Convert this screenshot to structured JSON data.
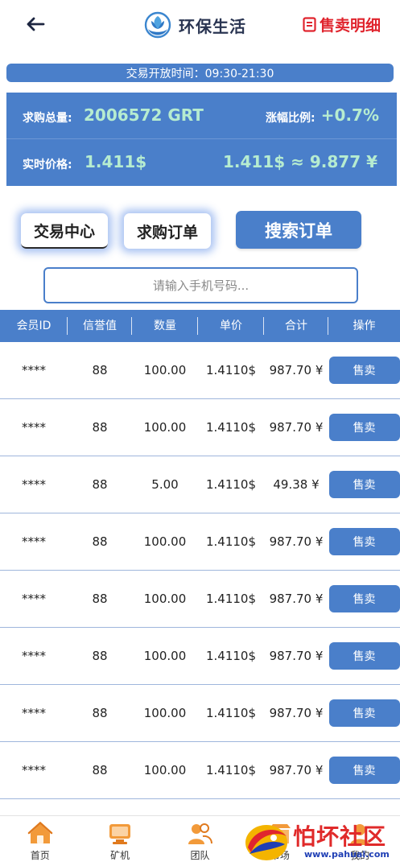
{
  "header": {
    "brand_name": "环保生活",
    "sell_detail_label": "售卖明细"
  },
  "trade_time": "交易开放时间：09:30-21:30",
  "stats": {
    "total_label": "求购总量:",
    "total_value": "2006572 GRT",
    "change_label": "涨幅比例:",
    "change_value": "+0.7%",
    "price_label": "实时价格:",
    "price_value": "1.411$",
    "conversion": "1.411$ ≈ 9.877 ¥"
  },
  "tabs": {
    "center": "交易中心",
    "orders": "求购订单",
    "search": "搜索订单"
  },
  "search": {
    "placeholder": "请输入手机号码..."
  },
  "table": {
    "headers": [
      "会员ID",
      "信誉值",
      "数量",
      "单价",
      "合计",
      "操作"
    ],
    "rows": [
      {
        "id": "****",
        "credit": "88",
        "qty": "100.00",
        "price": "1.4110$",
        "total": "987.70 ¥",
        "action": "售卖"
      },
      {
        "id": "****",
        "credit": "88",
        "qty": "100.00",
        "price": "1.4110$",
        "total": "987.70 ¥",
        "action": "售卖"
      },
      {
        "id": "****",
        "credit": "88",
        "qty": "5.00",
        "price": "1.4110$",
        "total": "49.38 ¥",
        "action": "售卖"
      },
      {
        "id": "****",
        "credit": "88",
        "qty": "100.00",
        "price": "1.4110$",
        "total": "987.70 ¥",
        "action": "售卖"
      },
      {
        "id": "****",
        "credit": "88",
        "qty": "100.00",
        "price": "1.4110$",
        "total": "987.70 ¥",
        "action": "售卖"
      },
      {
        "id": "****",
        "credit": "88",
        "qty": "100.00",
        "price": "1.4110$",
        "total": "987.70 ¥",
        "action": "售卖"
      },
      {
        "id": "****",
        "credit": "88",
        "qty": "100.00",
        "price": "1.4110$",
        "total": "987.70 ¥",
        "action": "售卖"
      },
      {
        "id": "****",
        "credit": "88",
        "qty": "100.00",
        "price": "1.4110$",
        "total": "987.70 ¥",
        "action": "售卖"
      }
    ]
  },
  "nav": {
    "items": [
      {
        "label": "首页",
        "icon": "home-icon"
      },
      {
        "label": "矿机",
        "icon": "mining-machine-icon"
      },
      {
        "label": "团队",
        "icon": "team-icon"
      },
      {
        "label": "市场",
        "icon": "market-icon"
      },
      {
        "label": "我的",
        "icon": "profile-icon"
      }
    ]
  },
  "watermark": {
    "text": "怕坏社区",
    "url": "www.pahuai.com"
  },
  "colors": {
    "primary": "#4a7fca",
    "accent_red": "#e0252e",
    "value_green": "#b6ecd0"
  }
}
